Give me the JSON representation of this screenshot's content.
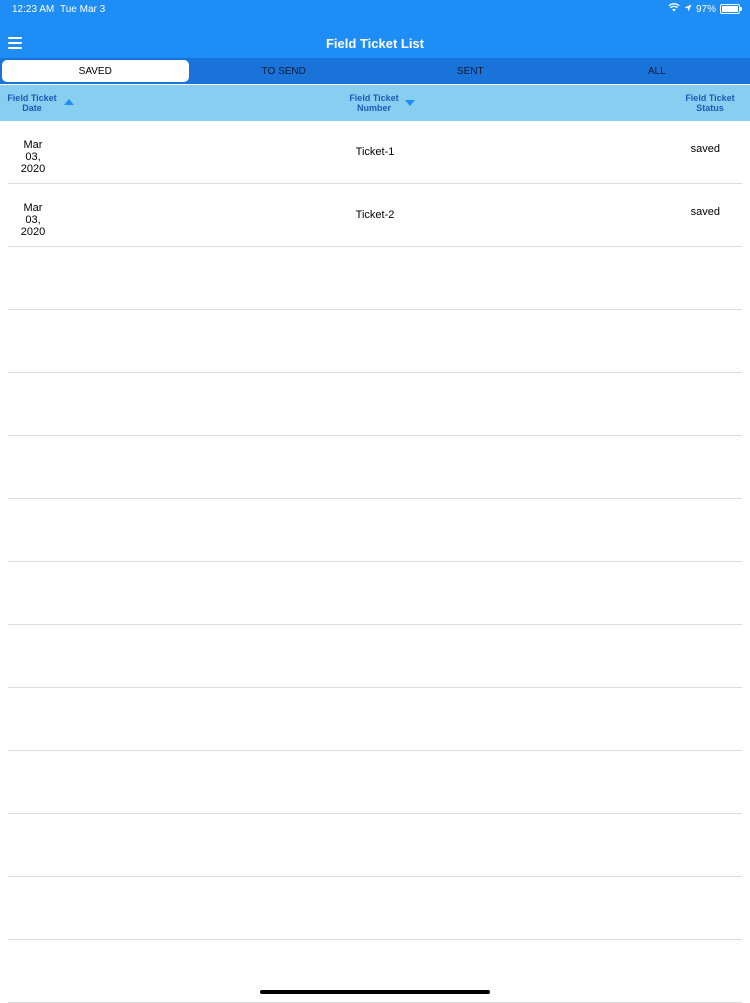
{
  "status_bar": {
    "time": "12:23 AM",
    "date": "Tue Mar 3",
    "battery_percent": "97%",
    "battery_level": 0.97
  },
  "nav": {
    "title": "Field Ticket List",
    "menu_icon": "hamburger-menu-icon"
  },
  "tabs": [
    {
      "label": "SAVED",
      "active": true
    },
    {
      "label": "TO SEND",
      "active": false
    },
    {
      "label": "SENT",
      "active": false
    },
    {
      "label": "ALL",
      "active": false
    }
  ],
  "table": {
    "headers": {
      "date_line1": "Field Ticket",
      "date_line2": "Date",
      "number_line1": "Field Ticket",
      "number_line2": "Number",
      "status_line1": "Field Ticket",
      "status_line2": "Status"
    },
    "rows": [
      {
        "date_month": "Mar",
        "date_day": "03,",
        "date_year": "2020",
        "number": "Ticket-1",
        "status": "saved"
      },
      {
        "date_month": "Mar",
        "date_day": "03,",
        "date_year": "2020",
        "number": "Ticket-2",
        "status": "saved"
      }
    ],
    "empty_row_count": 12
  },
  "colors": {
    "nav_background": "#1e8df5",
    "tabs_background": "#1a73d9",
    "header_background": "#87cef0",
    "header_text": "#1b5bb5"
  }
}
